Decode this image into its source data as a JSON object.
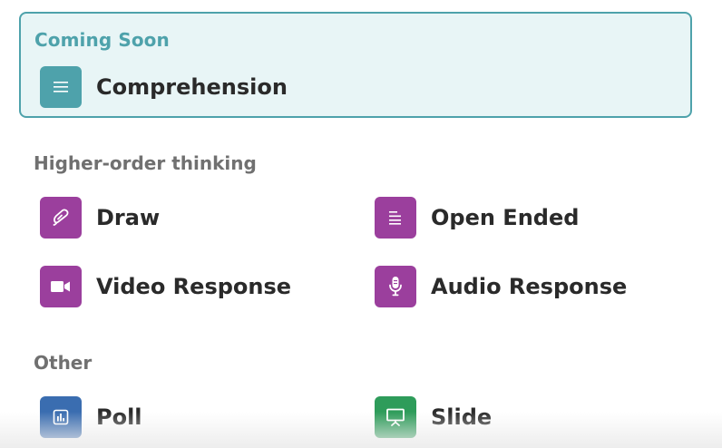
{
  "coming_soon": {
    "label": "Coming Soon",
    "items": [
      {
        "label": "Comprehension",
        "icon": "align-lines-icon",
        "color": "#4ea2ab"
      }
    ]
  },
  "sections": [
    {
      "label": "Higher-order thinking",
      "items": [
        {
          "label": "Draw",
          "icon": "paintbrush-icon",
          "color": "#9b3f9d"
        },
        {
          "label": "Open Ended",
          "icon": "text-lines-icon",
          "color": "#9b3f9d"
        },
        {
          "label": "Video Response",
          "icon": "video-camera-icon",
          "color": "#9b3f9d"
        },
        {
          "label": "Audio Response",
          "icon": "microphone-icon",
          "color": "#9b3f9d"
        }
      ]
    },
    {
      "label": "Other",
      "items": [
        {
          "label": "Poll",
          "icon": "bar-chart-icon",
          "color": "#3a6db0"
        },
        {
          "label": "Slide",
          "icon": "presentation-board-icon",
          "color": "#2e9c5a"
        }
      ]
    }
  ]
}
